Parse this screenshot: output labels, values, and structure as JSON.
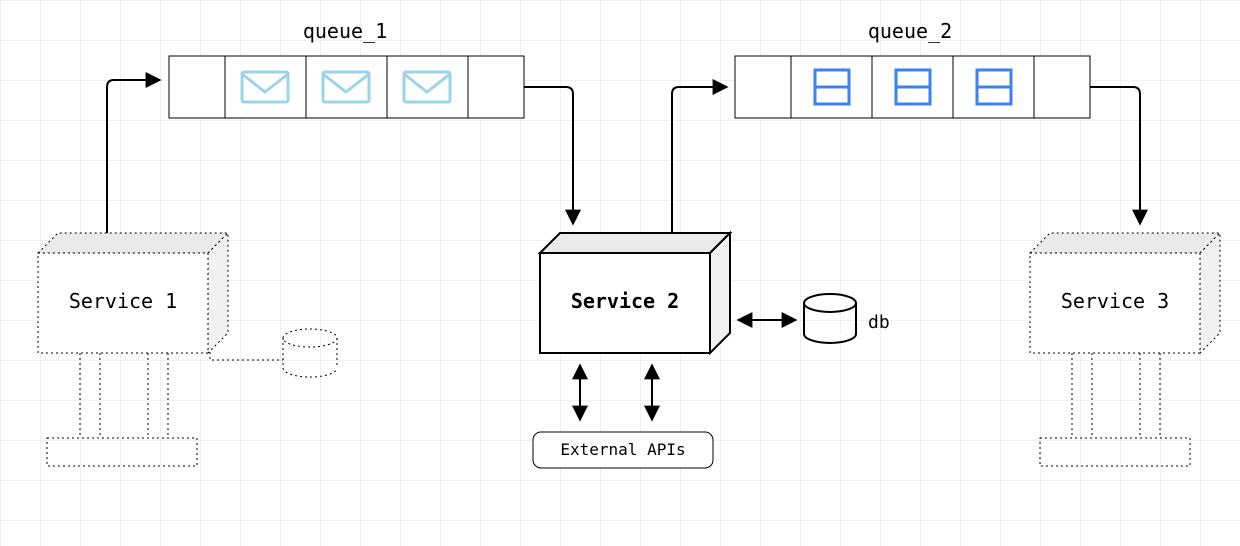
{
  "queues": {
    "queue1": {
      "label": "queue_1",
      "icon_count": 3,
      "icon_kind": "envelope"
    },
    "queue2": {
      "label": "queue_2",
      "icon_count": 3,
      "icon_kind": "split-rect"
    }
  },
  "services": {
    "service1": {
      "label": "Service 1",
      "style": "dotted",
      "bold": false
    },
    "service2": {
      "label": "Service 2",
      "style": "solid",
      "bold": true
    },
    "service3": {
      "label": "Service 3",
      "style": "dotted",
      "bold": false
    }
  },
  "db": {
    "label": "db"
  },
  "external_apis": {
    "label": "External APIs"
  },
  "colors": {
    "queue1_icon": "#9BD4EA",
    "queue2_icon": "#3B82F6",
    "stroke": "#000000"
  }
}
